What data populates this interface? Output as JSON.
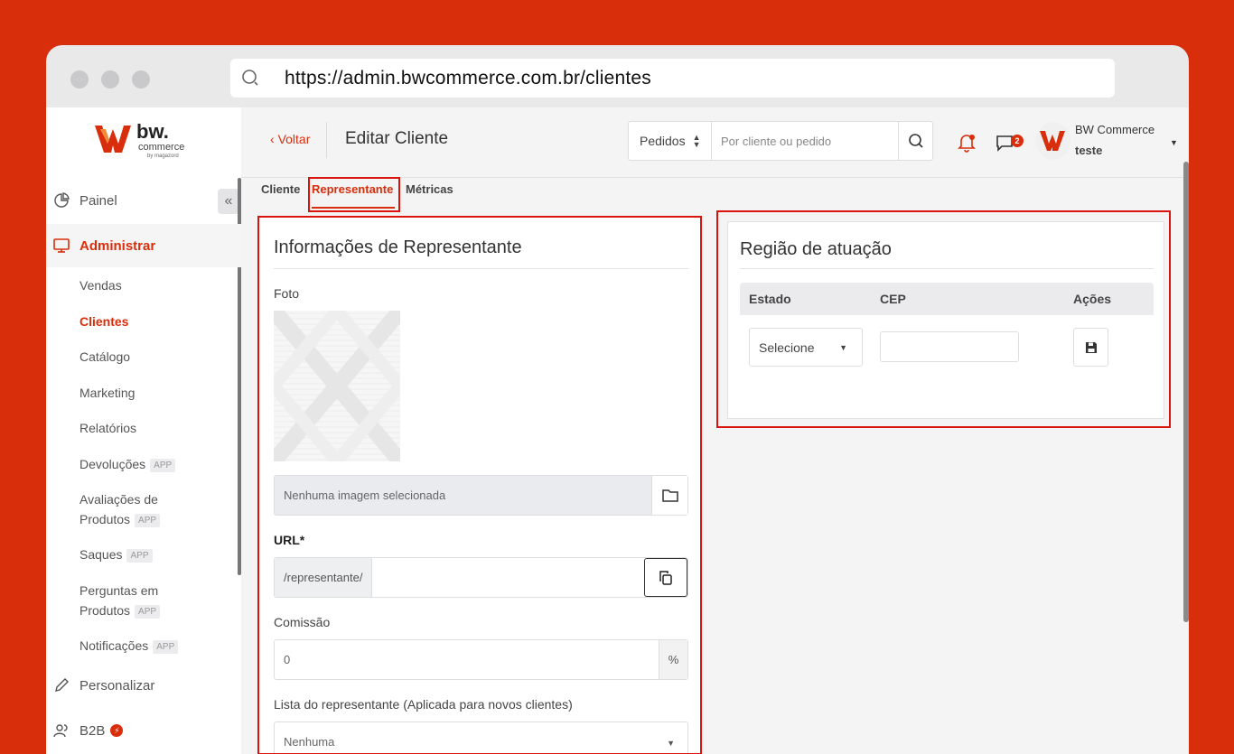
{
  "browser": {
    "url": "https://admin.bwcommerce.com.br/clientes"
  },
  "brand": {
    "accent": "#d92e0c",
    "logo_text": "bw.",
    "logo_sub": "commerce",
    "logo_by": "by magazord"
  },
  "sidebar": {
    "collapse_label": "«",
    "items": [
      {
        "label": "Painel"
      },
      {
        "label": "Administrar"
      },
      {
        "label": "Personalizar"
      },
      {
        "label": "B2B"
      }
    ],
    "sub_items": [
      {
        "label": "Vendas"
      },
      {
        "label": "Clientes"
      },
      {
        "label": "Catálogo"
      },
      {
        "label": "Marketing"
      },
      {
        "label": "Relatórios"
      },
      {
        "label": "Devoluções",
        "badge": "APP"
      },
      {
        "label": "Avaliações de",
        "label2": "Produtos",
        "badge": "APP"
      },
      {
        "label": "Saques",
        "badge": "APP"
      },
      {
        "label": "Perguntas em",
        "label2": "Produtos",
        "badge": "APP"
      },
      {
        "label": "Notificações",
        "badge": "APP"
      }
    ]
  },
  "header": {
    "back_label": "Voltar",
    "title": "Editar Cliente",
    "search_scope": "Pedidos",
    "search_placeholder": "Por cliente ou pedido",
    "messages_count": "2",
    "user_name": "BW Commerce",
    "user_store": "teste"
  },
  "tabs": [
    {
      "label": "Cliente"
    },
    {
      "label": "Representante"
    },
    {
      "label": "Métricas"
    }
  ],
  "rep_info": {
    "title": "Informações de Representante",
    "photo_label": "Foto",
    "no_image": "Nenhuma imagem selecionada",
    "url_label": "URL*",
    "url_prefix": "/representante/",
    "commission_label": "Comissão",
    "commission_value": "0",
    "commission_unit": "%",
    "list_label": "Lista do representante (Aplicada para novos clientes)",
    "list_value": "Nenhuma"
  },
  "region": {
    "title": "Região de atuação",
    "columns": [
      "Estado",
      "CEP",
      "Ações"
    ],
    "estado_value": "Selecione"
  }
}
